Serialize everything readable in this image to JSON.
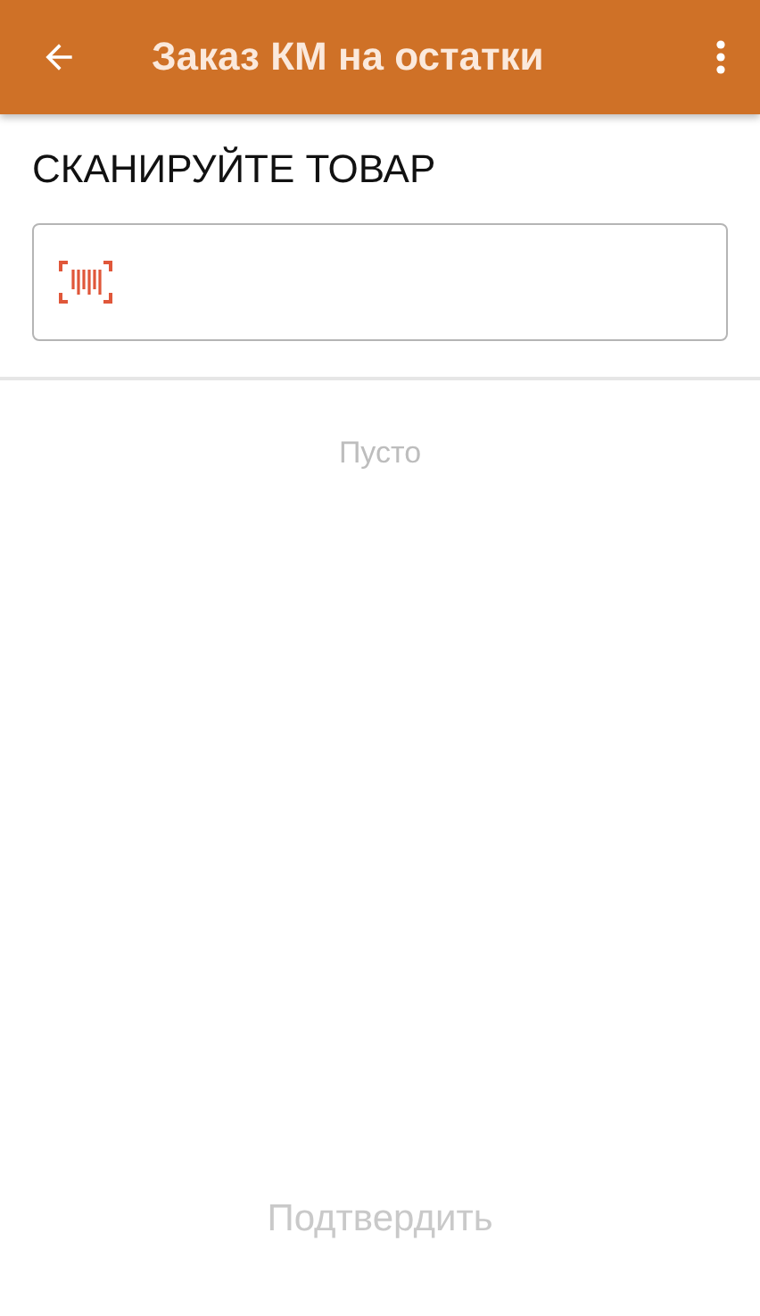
{
  "app_bar": {
    "title": "Заказ КМ на остатки"
  },
  "heading": "СКАНИРУЙТЕ ТОВАР",
  "list": {
    "empty_text": "Пусто"
  },
  "confirm_button": {
    "label": "Подтвердить",
    "disabled": true
  }
}
